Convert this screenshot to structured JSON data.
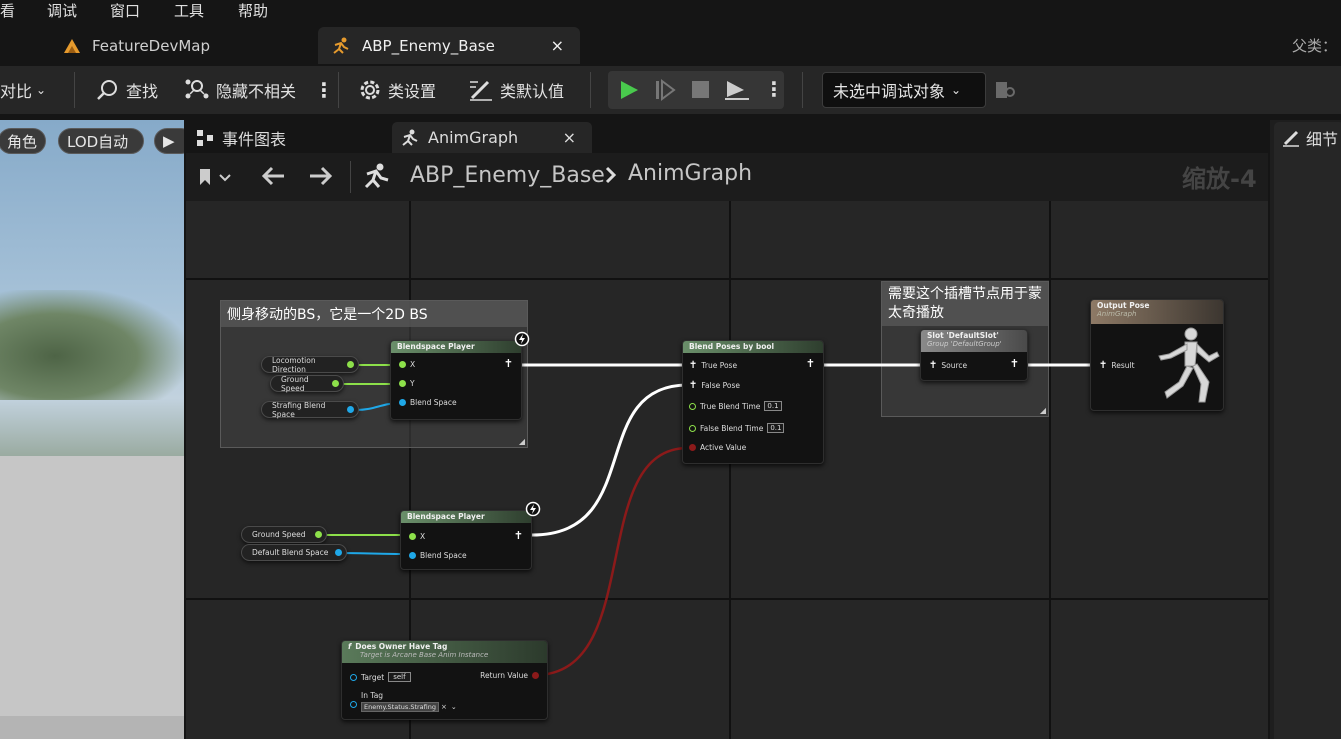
{
  "menu": {
    "view": "看",
    "debug": "调试",
    "window": "窗口",
    "tools": "工具",
    "help": "帮助"
  },
  "tabs": [
    {
      "label": "FeatureDevMap"
    },
    {
      "label": "ABP_Enemy_Base",
      "close": "×"
    }
  ],
  "parent_label": "父类：",
  "toolbar": {
    "diff": "对比",
    "find": "查找",
    "hide_unrelated": "隐藏不相关",
    "class_settings": "类设置",
    "class_defaults": "类默认值",
    "debug_object": "未选中调试对象"
  },
  "viewport": {
    "character": "角色",
    "lod": "LOD自动"
  },
  "graph_tabs": [
    {
      "label": "事件图表"
    },
    {
      "label": "AnimGraph",
      "close": "×"
    }
  ],
  "details_tab": "细节",
  "breadcrumb": {
    "asset": "ABP_Enemy_Base",
    "graph": "AnimGraph",
    "zoom": "缩放-4"
  },
  "comments": [
    {
      "text": "侧身移动的BS，它是一个2D BS"
    },
    {
      "text": "需要这个插槽节点用于蒙太奇播放"
    }
  ],
  "vars": {
    "locomotion_direction": "Locomotion Direction",
    "ground_speed": "Ground Speed",
    "strafing_blend_space": "Strafing Blend Space",
    "ground_speed_2": "Ground Speed",
    "default_blend_space": "Default Blend Space"
  },
  "nodes": {
    "bs1": {
      "title": "Blendspace Player",
      "pin_x": "X",
      "pin_y": "Y",
      "pin_bs": "Blend Space"
    },
    "bs2": {
      "title": "Blendspace Player",
      "pin_x": "X",
      "pin_bs": "Blend Space"
    },
    "blend": {
      "title": "Blend Poses by bool",
      "true_pose": "True Pose",
      "false_pose": "False Pose",
      "true_time": "True Blend Time",
      "true_time_val": "0.1",
      "false_time": "False Blend Time",
      "false_time_val": "0.1",
      "active": "Active Value"
    },
    "slot": {
      "title": "Slot 'DefaultSlot'",
      "subtitle": "Group 'DefaultGroup'",
      "source": "Source"
    },
    "output": {
      "title": "Output Pose",
      "subtitle": "AnimGraph",
      "result": "Result"
    },
    "tag": {
      "title": "Does Owner Have Tag",
      "subtitle": "Target is Arcane Base Anim Instance",
      "target": "Target",
      "target_val": "self",
      "return": "Return Value",
      "in_tag": "In Tag",
      "tag_val": "Enemy.Status.Strafing"
    }
  },
  "colors": {
    "exec_white": "#ffffff",
    "float_green": "#8de04a",
    "object_blue": "#1fa8e8",
    "bool_red": "#8b1a1a",
    "play_green": "#49c94d"
  }
}
